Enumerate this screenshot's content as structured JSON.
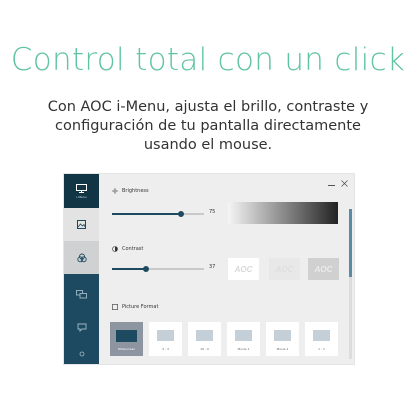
{
  "headline": "Control total con un click",
  "subtitle": {
    "line1": "Con AOC i-Menu, ajusta el brillo, contraste y",
    "line2": "configuración de tu pantalla directamente",
    "line3": "usando el mouse."
  },
  "app": {
    "sidebar_logo_label": "i-Menu",
    "brightness": {
      "label": "Brightness",
      "value": "75",
      "level": 75
    },
    "contrast": {
      "label": "Contrast",
      "value": "37",
      "level": 37
    },
    "contrast_previews": [
      "AOC",
      "AOC",
      "AOC"
    ],
    "picture_format": {
      "label": "Picture Format",
      "options": [
        "Widescreen",
        "4 : 3",
        "16 : 9",
        "Movie 1",
        "Movie 2",
        "1 : 1"
      ],
      "selected": "Widescreen"
    },
    "colors": {
      "sidebar": "#1d4a60",
      "accent": "#1d4a60",
      "headline": "#5fc4a2"
    }
  }
}
